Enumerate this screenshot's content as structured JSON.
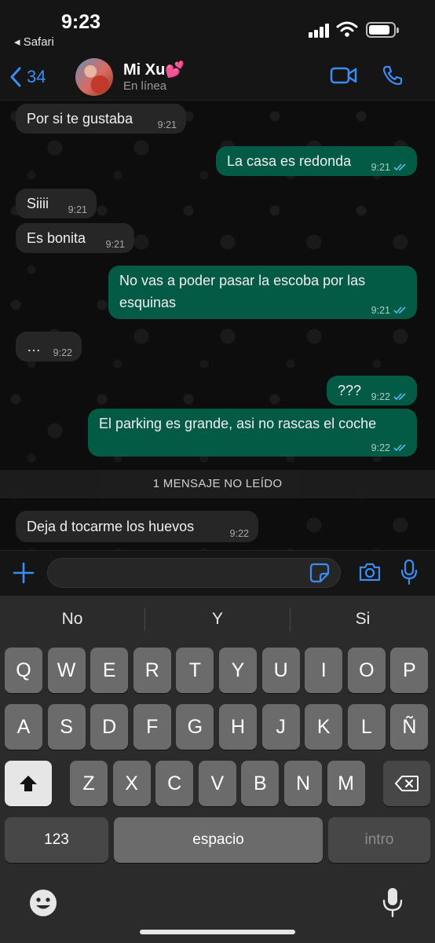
{
  "status_bar": {
    "time": "9:23",
    "back_app": "◂ Safari",
    "battery_percent": 85
  },
  "header": {
    "back_count": "34",
    "contact_name": "Mi Xu💕",
    "contact_status": "En línea"
  },
  "messages": [
    {
      "text": "Por si te gustaba",
      "time": "9:21",
      "dir": "in"
    },
    {
      "text": "La casa es redonda",
      "time": "9:21",
      "dir": "out"
    },
    {
      "text": "Siiii",
      "time": "9:21",
      "dir": "in"
    },
    {
      "text": "Es bonita",
      "time": "9:21",
      "dir": "in"
    },
    {
      "text": "No vas a poder pasar la escoba por las esquinas",
      "time": "9:21",
      "dir": "out"
    },
    {
      "text": "…",
      "time": "9:22",
      "dir": "in"
    },
    {
      "text": "???",
      "time": "9:22",
      "dir": "out"
    },
    {
      "text": "El parking es grande, asi no rascas el coche",
      "time": "9:22",
      "dir": "out"
    },
    {
      "text": "Deja d tocarme los huevos",
      "time": "9:22",
      "dir": "in"
    }
  ],
  "unread_banner": "1 MENSAJE NO LEÍDO",
  "input": {
    "value": "",
    "placeholder": ""
  },
  "keyboard": {
    "suggestions": [
      "No",
      "Y",
      "Si"
    ],
    "row1": [
      "Q",
      "W",
      "E",
      "R",
      "T",
      "Y",
      "U",
      "I",
      "O",
      "P"
    ],
    "row2": [
      "A",
      "S",
      "D",
      "F",
      "G",
      "H",
      "J",
      "K",
      "L",
      "Ñ"
    ],
    "row3": [
      "Z",
      "X",
      "C",
      "V",
      "B",
      "N",
      "M"
    ],
    "numbers_label": "123",
    "space_label": "espacio",
    "return_label": "intro"
  },
  "colors": {
    "accent": "#3a8df5",
    "outgoing_bubble": "#035a45",
    "incoming_bubble": "#262626"
  }
}
